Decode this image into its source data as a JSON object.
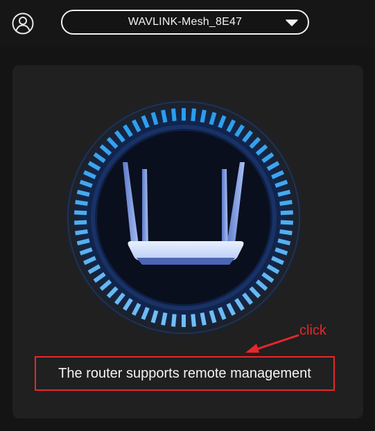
{
  "header": {
    "network_name": "WAVLINK-Mesh_8E47",
    "account_icon": "user-circle-icon",
    "dropdown_icon": "caret-down-icon"
  },
  "main": {
    "router_icon": "router-icon",
    "remote_management_text": "The router supports remote management"
  },
  "annotation": {
    "label": "click",
    "color": "#e8262b"
  },
  "colors": {
    "background": "#141414",
    "card": "#202020",
    "ring_accent": "#2fa6ee",
    "router_body": "#c9dcff"
  }
}
